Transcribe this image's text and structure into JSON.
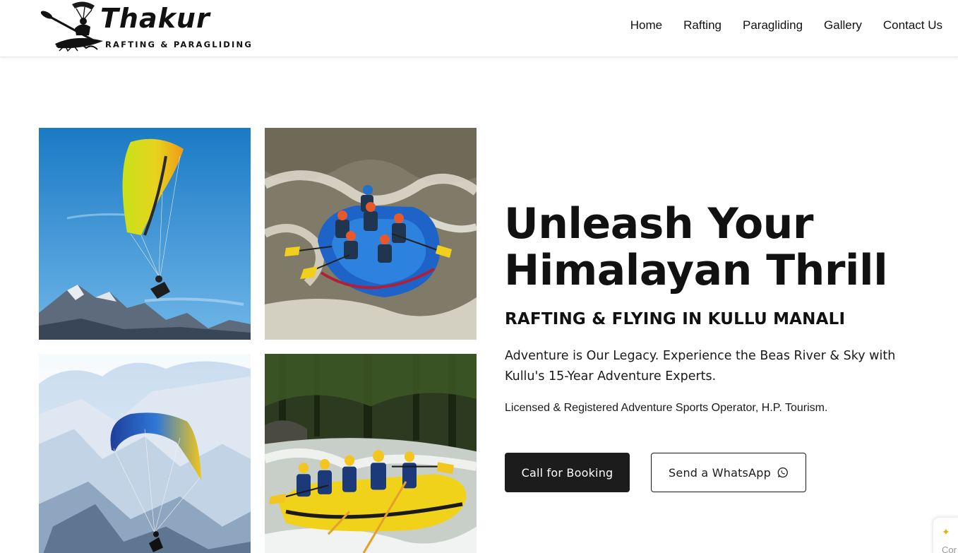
{
  "header": {
    "logo": {
      "title": "Thakur",
      "subtitle": "RAFTING & PARAGLIDING",
      "icon": "paraglider-kayak-logo"
    },
    "nav": [
      {
        "label": "Home"
      },
      {
        "label": "Rafting"
      },
      {
        "label": "Paragliding"
      },
      {
        "label": "Gallery"
      },
      {
        "label": "Contact Us"
      }
    ]
  },
  "gallery": {
    "images": [
      {
        "subject": "paraglider over mountains, blue sky"
      },
      {
        "subject": "rafting team in blue raft"
      },
      {
        "subject": "paraglider above snowy peaks"
      },
      {
        "subject": "rafting team in yellow raft"
      }
    ]
  },
  "hero": {
    "title_line1": "Unleash Your",
    "title_line2": "Himalayan Thrill",
    "subtitle": "RAFTING & FLYING IN KULLU MANALI",
    "description": "Adventure is Our Legacy. Experience the Beas River & Sky with Kullu's 15-Year Adventure Experts.",
    "license": "Licensed & Registered Adventure Sports Operator, H.P. Tourism.",
    "primary_button": "Call for Booking",
    "secondary_button": "Send a WhatsApp",
    "secondary_icon": "whatsapp-icon"
  },
  "corner_widget": {
    "text": "Cor"
  },
  "colors": {
    "primary_button_bg": "#1c1c1c",
    "text": "#111111",
    "background": "#ffffff"
  }
}
